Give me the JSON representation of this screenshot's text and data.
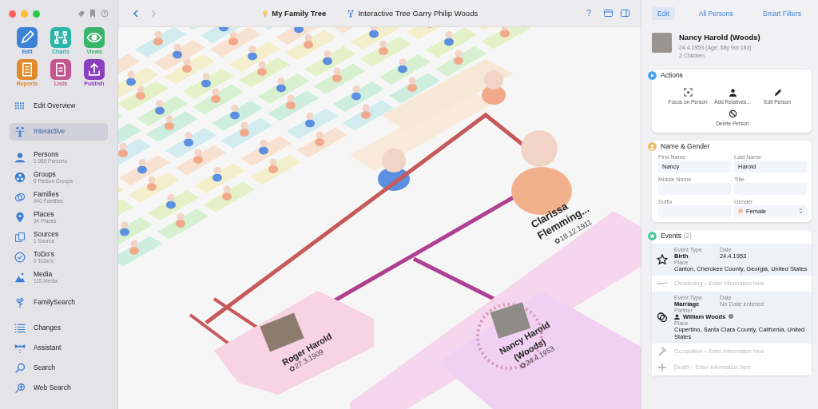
{
  "window": {
    "controls": [
      {
        "kind": "close"
      },
      {
        "kind": "minimize"
      },
      {
        "kind": "zoom"
      }
    ]
  },
  "sidebar": {
    "apps": [
      {
        "label": "Edit",
        "color": "#3b82d6"
      },
      {
        "label": "Charts",
        "color": "#2bb5a8"
      },
      {
        "label": "Views",
        "color": "#39b46a"
      },
      {
        "label": "Reports",
        "color": "#e08a2c"
      },
      {
        "label": "Lists",
        "color": "#c4568f"
      },
      {
        "label": "Publish",
        "color": "#8a3fc0"
      }
    ],
    "sections": [
      [
        {
          "label": "Edit Overview",
          "selected": false
        }
      ],
      [
        {
          "label": "Interactive",
          "selected": true
        }
      ],
      [
        {
          "label": "Persons",
          "subtitle": "1.986 Persons",
          "selected": false
        },
        {
          "label": "Groups",
          "subtitle": "0 Person Groups",
          "selected": false
        },
        {
          "label": "Families",
          "subtitle": "940 Families",
          "selected": false
        },
        {
          "label": "Places",
          "subtitle": "34 Places",
          "selected": false
        },
        {
          "label": "Sources",
          "subtitle": "1 Source",
          "selected": false
        },
        {
          "label": "ToDo's",
          "subtitle": "0 ToDo's",
          "selected": false
        },
        {
          "label": "Media",
          "subtitle": "115 Media",
          "selected": false
        }
      ],
      [
        {
          "label": "FamilySearch",
          "selected": false
        }
      ],
      [
        {
          "label": "Changes",
          "selected": false
        },
        {
          "label": "Assistant",
          "selected": false
        },
        {
          "label": "Search",
          "selected": false
        },
        {
          "label": "Web Search",
          "selected": false
        }
      ]
    ]
  },
  "toolbar": {
    "nav": [
      {
        "kind": "back",
        "disabled": false
      },
      {
        "kind": "forward",
        "disabled": true
      }
    ],
    "breadcrumbs": [
      "My Family Tree",
      "Interactive Tree Garry Philip Woods"
    ],
    "help": "?"
  },
  "tree": {
    "persons": [
      {
        "name": "Clarissa",
        "name2": "Flemming...",
        "date": "✿18.12.1911",
        "kind": "large"
      },
      {
        "name": "Roger Harold",
        "date": "✿27.3.1909",
        "kind": "photo"
      },
      {
        "name": "Nancy Harold",
        "name2": "(Woods)",
        "date": "✿24.4.1953",
        "kind": "selected"
      }
    ]
  },
  "inspector": {
    "tabs": [
      {
        "label": "Edit",
        "selected": true
      },
      {
        "label": "All Persons",
        "selected": false
      },
      {
        "label": "Smart Filters",
        "selected": false
      }
    ],
    "person": {
      "name": "Nancy Harold (Woods)",
      "dates": "24.4.1953 (Age: 68y 9m 18d)",
      "children": "2 Children"
    },
    "actions": {
      "title": "Actions",
      "items": [
        "Focus on Person",
        "Add Relatives...",
        "Edit Person",
        "Delete Person"
      ]
    },
    "name_gender": {
      "title": "Name & Gender",
      "fields": [
        {
          "label": "First Name",
          "value": "Nancy"
        },
        {
          "label": "Last Name",
          "value": "Harold"
        },
        {
          "label": "Middle Name"
        },
        {
          "label": "Title"
        },
        {
          "label": "Suffix"
        },
        {
          "label": "Gender",
          "value": "Female",
          "color": "#f3c3a6",
          "kind": "select"
        }
      ]
    },
    "events": {
      "title": "Events",
      "count": "(2)",
      "items": [
        {
          "kind": "event",
          "type_label": "Event Type",
          "type": "Birth",
          "date_label": "Date",
          "date": "24.4.1953",
          "place_label": "Place",
          "place": "Canton, Cherokee County, Georgia, United States"
        },
        {
          "kind": "empty",
          "text": "Christening – Enter Information here"
        },
        {
          "kind": "event",
          "type_label": "Event Type",
          "type": "Marriage",
          "date_label": "Date",
          "date_placeholder": "No Date entered",
          "partner_label": "Partner",
          "partner": "William Woods",
          "place_label": "Place",
          "place": "Cupertino, Santa Clara County, California, United States"
        },
        {
          "kind": "empty",
          "text": "Occupation – Enter Information here"
        },
        {
          "kind": "empty",
          "text": "Death – Enter Information here"
        }
      ]
    }
  }
}
